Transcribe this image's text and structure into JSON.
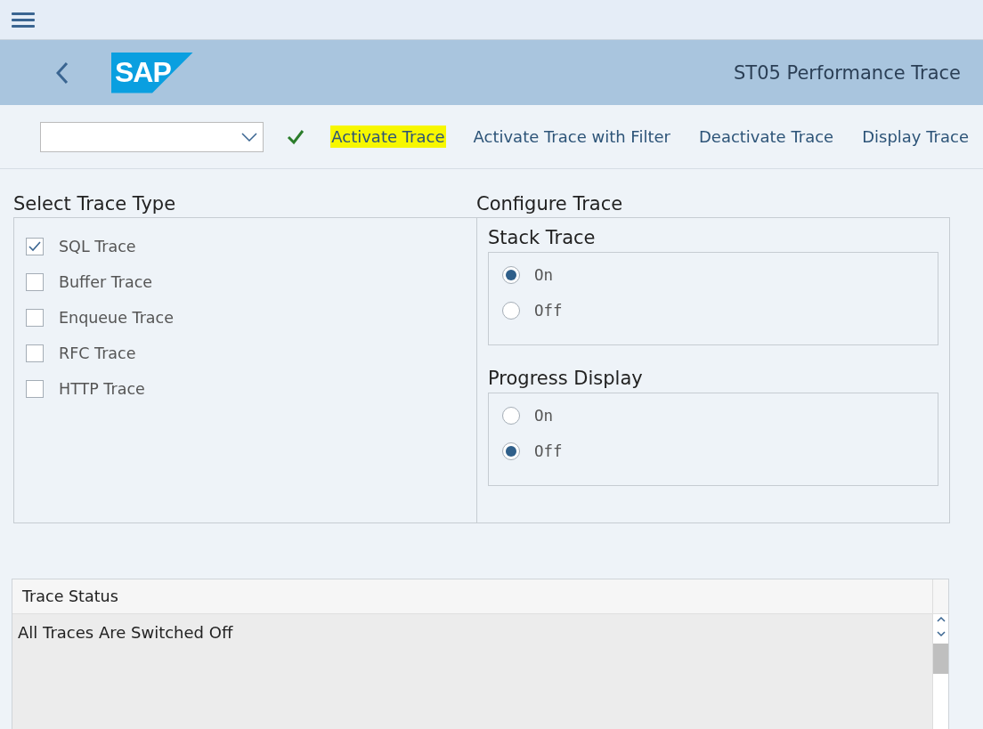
{
  "header": {
    "logo": "SAP",
    "title": "ST05 Performance Trace"
  },
  "toolbar": {
    "actions": [
      {
        "label": "Activate Trace",
        "highlighted": true
      },
      {
        "label": "Activate Trace with Filter",
        "highlighted": false
      },
      {
        "label": "Deactivate Trace",
        "highlighted": false
      },
      {
        "label": "Display Trace",
        "highlighted": false
      }
    ]
  },
  "trace_types": {
    "title": "Select Trace Type",
    "items": [
      {
        "label": "SQL Trace",
        "checked": true
      },
      {
        "label": "Buffer Trace",
        "checked": false
      },
      {
        "label": "Enqueue Trace",
        "checked": false
      },
      {
        "label": "RFC Trace",
        "checked": false
      },
      {
        "label": "HTTP Trace",
        "checked": false
      }
    ]
  },
  "configure": {
    "title": "Configure Trace",
    "groups": [
      {
        "title": "Stack Trace",
        "options": [
          {
            "label": "On",
            "selected": true
          },
          {
            "label": "Off",
            "selected": false
          }
        ]
      },
      {
        "title": "Progress Display",
        "options": [
          {
            "label": "On",
            "selected": false
          },
          {
            "label": "Off",
            "selected": true
          }
        ]
      }
    ]
  },
  "status": {
    "header": "Trace Status",
    "text": "All Traces Are Switched Off"
  }
}
